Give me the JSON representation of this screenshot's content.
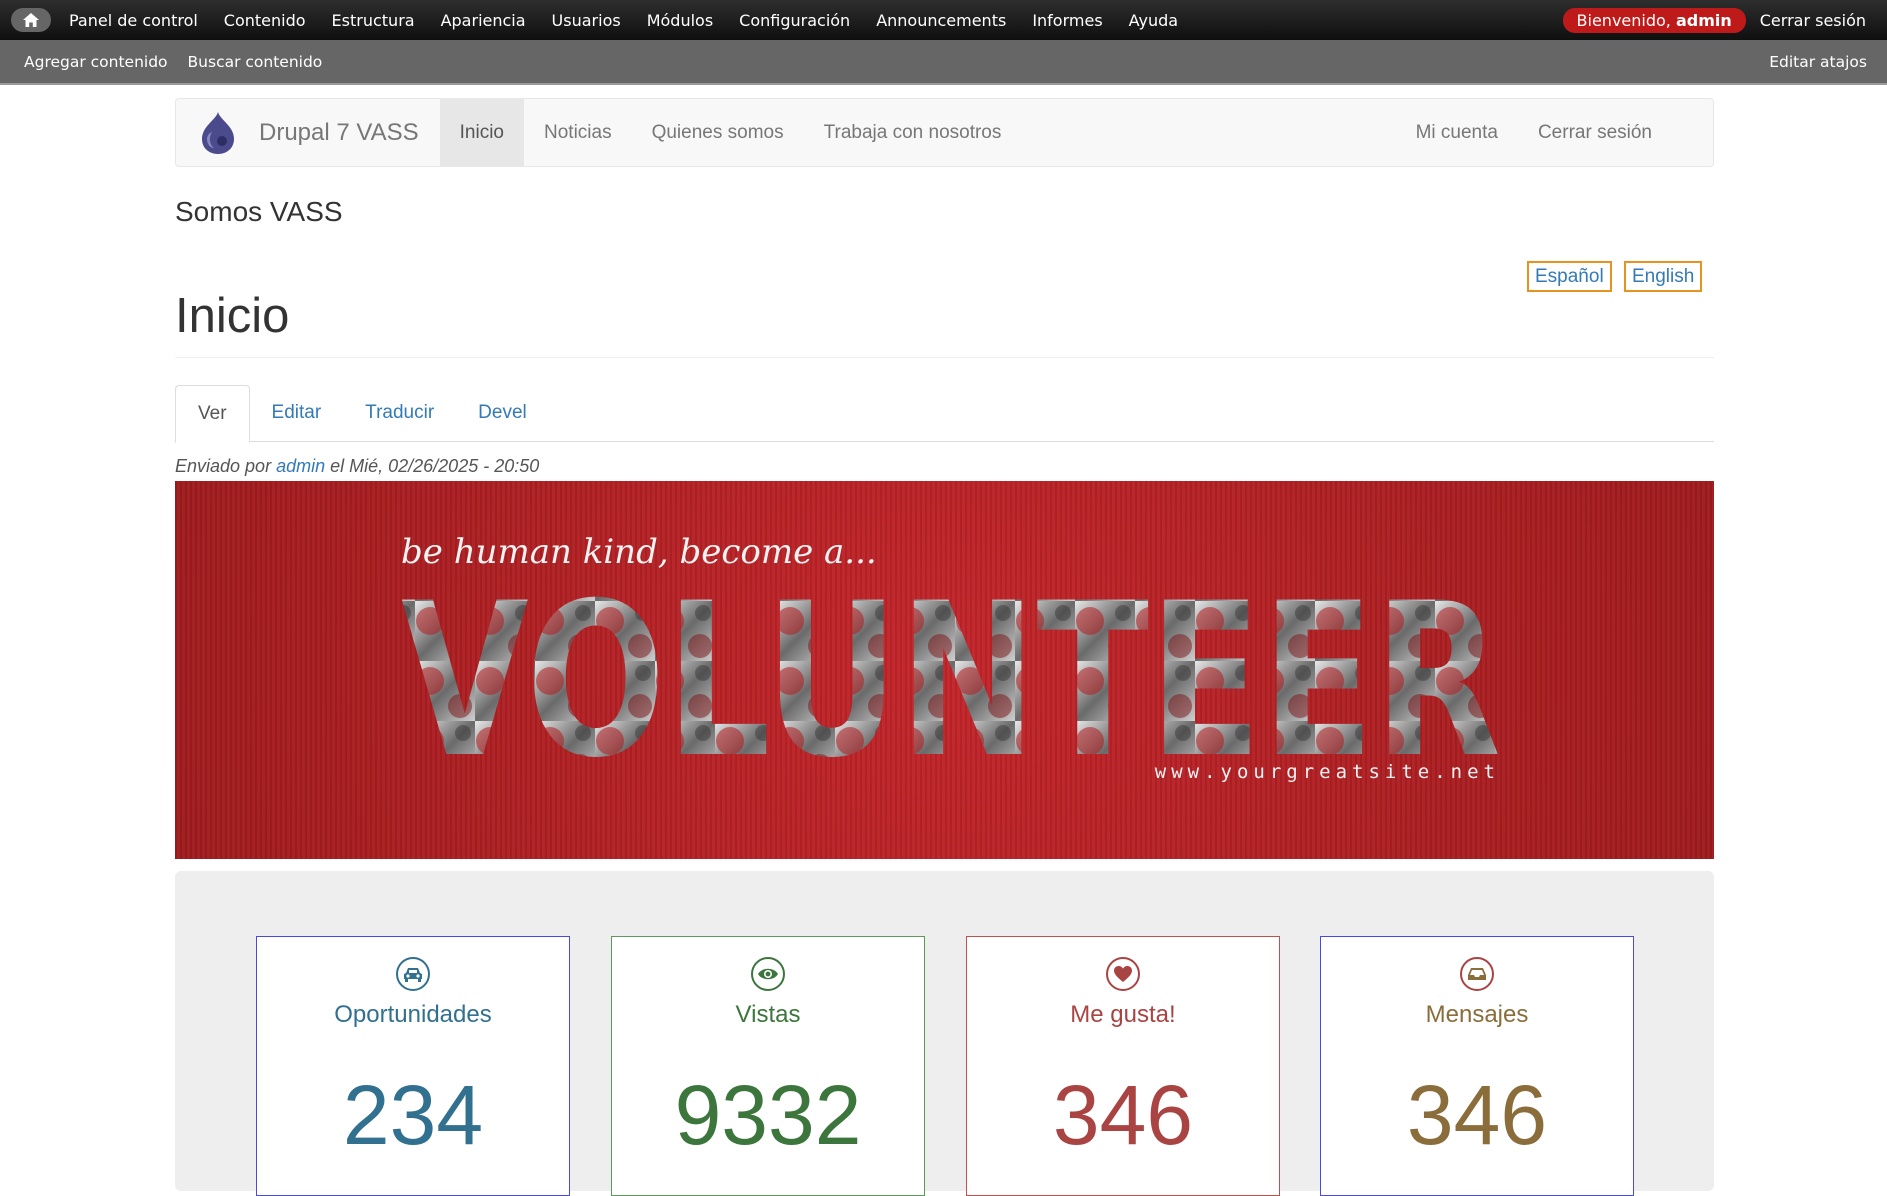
{
  "admin_toolbar": {
    "menu": [
      "Panel de control",
      "Contenido",
      "Estructura",
      "Apariencia",
      "Usuarios",
      "Módulos",
      "Configuración",
      "Announcements",
      "Informes",
      "Ayuda"
    ],
    "welcome_prefix": "Bienvenido, ",
    "welcome_user": "admin",
    "logout": "Cerrar sesión"
  },
  "shortcuts": {
    "items": [
      "Agregar contenido",
      "Buscar contenido"
    ],
    "edit": "Editar atajos"
  },
  "navbar": {
    "brand": "Drupal 7 VASS",
    "items": [
      "Inicio",
      "Noticias",
      "Quienes somos",
      "Trabaja con nosotros"
    ],
    "active_item": "Inicio",
    "right_items": [
      "Mi cuenta",
      "Cerrar sesión"
    ]
  },
  "site": {
    "slogan": "Somos VASS"
  },
  "language_switcher": [
    "Español",
    "English"
  ],
  "page": {
    "title": "Inicio",
    "tabs": [
      "Ver",
      "Editar",
      "Traducir",
      "Devel"
    ],
    "active_tab": "Ver",
    "submitted_prefix": "Enviado por ",
    "submitted_author": "admin",
    "submitted_suffix": " el Mié, 02/26/2025 - 20:50"
  },
  "banner": {
    "tagline": "be human kind, become a...",
    "headline": "VOLUNTEER",
    "url": "www.yourgreatsite.net"
  },
  "stats": [
    {
      "label": "Oportunidades",
      "value": "234",
      "icon": "car-icon",
      "color": "#31708f",
      "border": "#4a4adf"
    },
    {
      "label": "Vistas",
      "value": "9332",
      "icon": "eye-icon",
      "color": "#3c763d",
      "border": "#5a9a5a"
    },
    {
      "label": "Me gusta!",
      "value": "346",
      "icon": "heart-icon",
      "color": "#a94442",
      "border": "#c0504e"
    },
    {
      "label": "Mensajes",
      "value": "346",
      "icon": "inbox-icon",
      "color": "#8a6d3b",
      "border": "#4a4adf"
    }
  ]
}
